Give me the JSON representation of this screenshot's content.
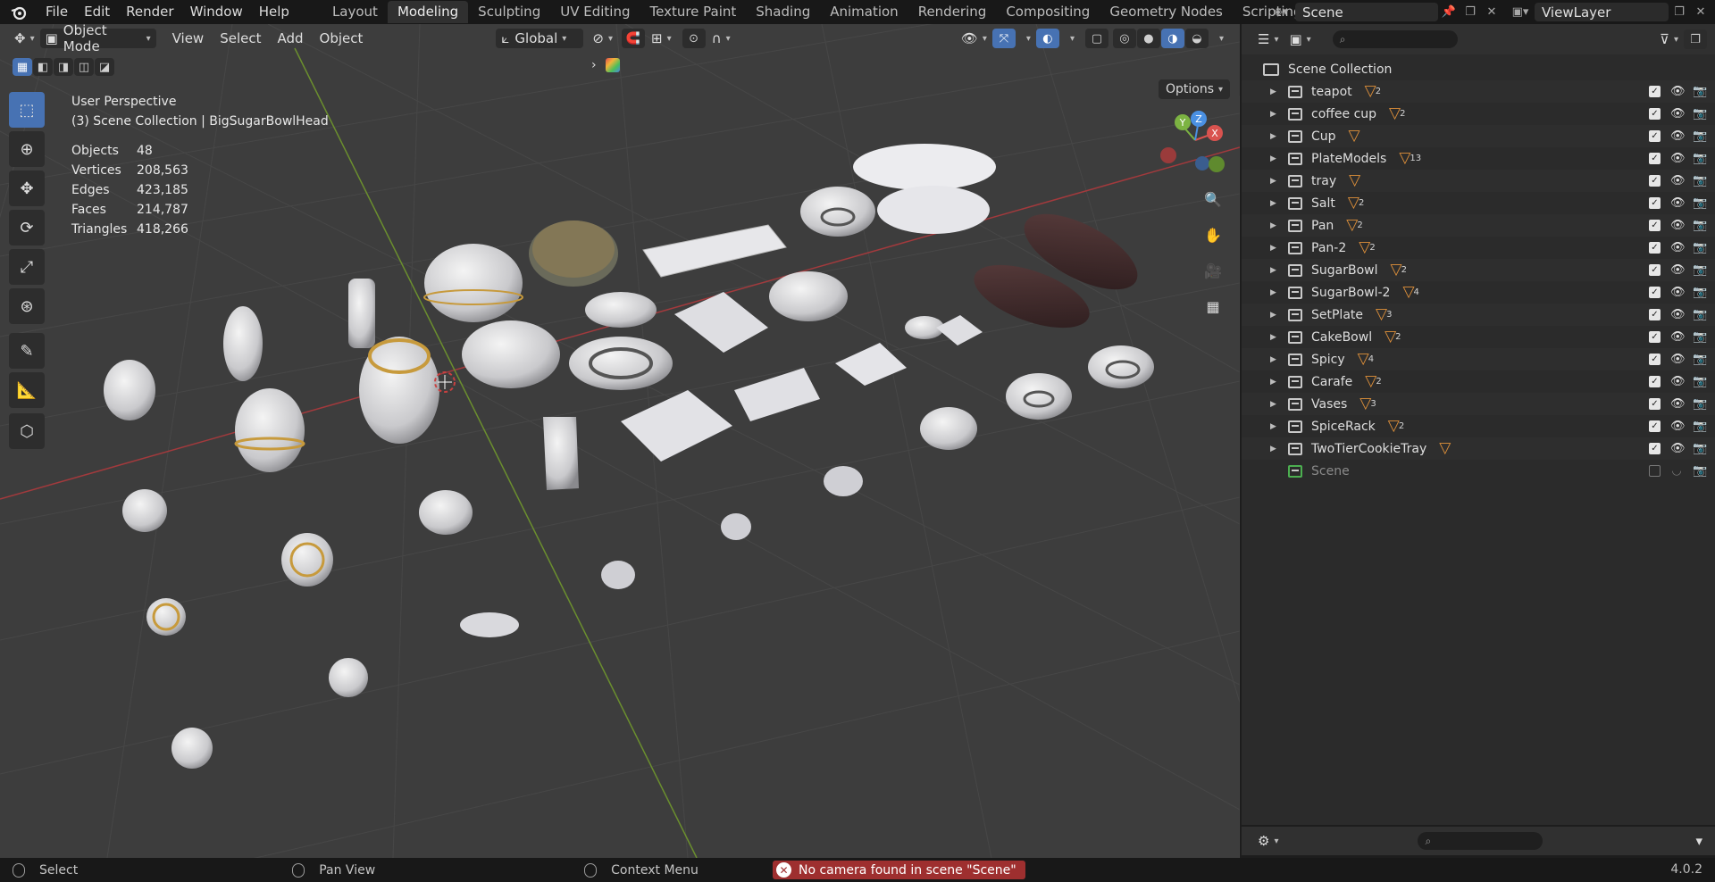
{
  "menu": [
    "File",
    "Edit",
    "Render",
    "Window",
    "Help"
  ],
  "workspaces": [
    "Layout",
    "Modeling",
    "Sculpting",
    "UV Editing",
    "Texture Paint",
    "Shading",
    "Animation",
    "Rendering",
    "Compositing",
    "Geometry Nodes",
    "Scripting"
  ],
  "active_workspace": "Modeling",
  "scene_name": "Scene",
  "view_layer": "ViewLayer",
  "viewport": {
    "mode": "Object Mode",
    "menus": [
      "View",
      "Select",
      "Add",
      "Object"
    ],
    "transform_orientation": "Global",
    "options_label": "Options",
    "view_name": "User Perspective",
    "context": "(3) Scene Collection | BigSugarBowlHead",
    "stats": [
      {
        "label": "Objects",
        "value": "48"
      },
      {
        "label": "Vertices",
        "value": "208,563"
      },
      {
        "label": "Edges",
        "value": "423,185"
      },
      {
        "label": "Faces",
        "value": "214,787"
      },
      {
        "label": "Triangles",
        "value": "418,266"
      }
    ],
    "gizmo_axes": [
      "X",
      "Y",
      "Z"
    ]
  },
  "outliner": {
    "root": "Scene Collection",
    "items": [
      {
        "name": "teapot",
        "count": "2"
      },
      {
        "name": "coffee cup",
        "count": "2"
      },
      {
        "name": "Cup",
        "count": ""
      },
      {
        "name": "PlateModels",
        "count": "13"
      },
      {
        "name": "tray",
        "count": ""
      },
      {
        "name": "Salt",
        "count": "2"
      },
      {
        "name": "Pan",
        "count": "2"
      },
      {
        "name": "Pan-2",
        "count": "2"
      },
      {
        "name": "SugarBowl",
        "count": "2"
      },
      {
        "name": "SugarBowl-2",
        "count": "4"
      },
      {
        "name": "SetPlate",
        "count": "3"
      },
      {
        "name": "CakeBowl",
        "count": "2"
      },
      {
        "name": "Spicy",
        "count": "4"
      },
      {
        "name": "Carafe",
        "count": "2"
      },
      {
        "name": "Vases",
        "count": "3"
      },
      {
        "name": "SpiceRack",
        "count": "2"
      },
      {
        "name": "TwoTierCookieTray",
        "count": ""
      }
    ],
    "scene_item": "Scene"
  },
  "statusbar": {
    "select": "Select",
    "pan": "Pan View",
    "context": "Context Menu",
    "error": "No camera found in scene \"Scene\"",
    "version": "4.0.2"
  },
  "colors": {
    "accent": "#4772b3",
    "mesh": "#e0913a",
    "error": "#9e2f2f"
  }
}
